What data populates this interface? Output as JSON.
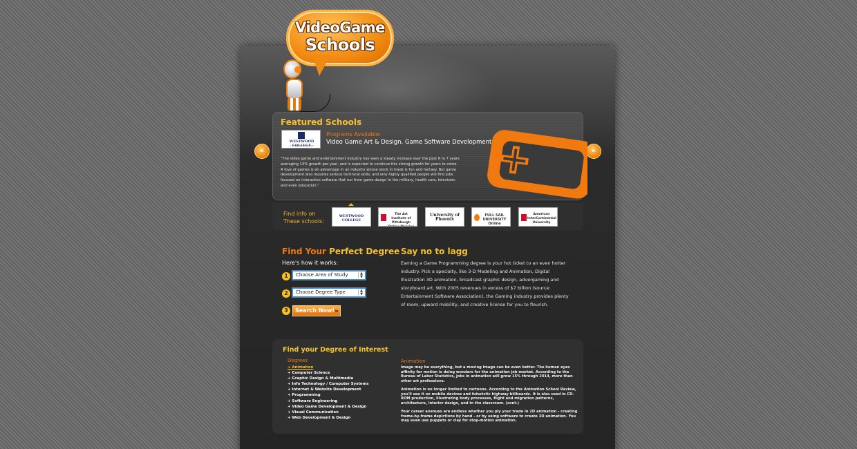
{
  "logo": {
    "line1": "VideoGame",
    "line2": "Schools"
  },
  "featured": {
    "title": "Featured Schools",
    "school_logo": {
      "name": "WESTWOOD COLLEGE",
      "sub": "A DEVRY INSTITUTE OF TECHNOLOGY"
    },
    "programs_label": "Programs Available:",
    "programs_value": "Video Game Art & Design, Game Software Development",
    "quote": "\"The video game and entertainment industry has seen a steady increase over the past 6 to 7 years averaging 14% growth per year, and is expected to continue this strong growth for years to come. A love of games is an advantage in an industry whose stock in trade is fun and fantasy. But game development also requires serious technical skills, and only highly qualified people will find jobs focused on interactive software that run from game design to the military, health care, television and even education.\"",
    "prev_arrow": "«",
    "next_arrow": "»"
  },
  "schools_strip": {
    "label": "Find info on These schools:",
    "schools": [
      {
        "name": "WESTWOOD COLLEGE"
      },
      {
        "name": "The Art Institute of Pittsburgh Online Division"
      },
      {
        "name": "University of Phoenix"
      },
      {
        "name": "FULL SAIL UNIVERSITY Online"
      },
      {
        "name": "American InterContinental University"
      }
    ]
  },
  "finder": {
    "title_a": "Find Your",
    "title_b": "Perfect Degree",
    "how": "Here's how it works:",
    "step1": "1",
    "step2": "2",
    "step3": "3",
    "area_select": "Choose Area of Study",
    "degree_select": "Choose Degree Type",
    "search_button": "Search Now!"
  },
  "lagg": {
    "title": "Say no to lagg",
    "text": "Earning a Game Programming degree is your hot ticket to an even hotter industry. Pick a specialty, like 3-D Modeling and Animation, Digital Illustration 3D animation, broadcast graphic design, advergaming and storyboard art. With 2005 revenues in excess of $7 billion (source: Entertainment Software Association), the Gaming industry provides plenty of room, upward mobility, and creative license for you to flourish."
  },
  "interest": {
    "title": "Find your Degree of Interest",
    "degrees_label": "Degrees",
    "degrees": [
      "+ Animation",
      "+ Computer Science",
      "+ Graphic Design & Multimedia",
      "+ Info Technology / Computer Systems",
      "+ Internet & Website Development",
      "+ Programming",
      "+ Software Engineering",
      "+ Video Game Development & Design",
      "+ Visual Communication",
      "+ Web Development & Design"
    ],
    "active_degree": 0,
    "animation_title": "Animation",
    "animation_paragraphs": [
      "Image may be everything, but a moving image can be even better. The human eyes affinity for motion is doing wonders for the animation job market. According to the Bureau of Labor Statistics, jobs in animation will grow 15% through 2014, more than other art professions.",
      "Animation is no longer limited to cartoons. According to the Animation School Review, you'll see it on mobile devices and futuristic highway billboards. It is also used in CD-ROM production, illustrating body processes, flight and migration patterns, architecture, interior design, and in the classroom. (cont.)",
      "Your career avenues are endless whether you ply your trade in 2D animation - creating frame-by-frame depictions by hand - or by using software to create 3D animation. You may even use puppets or clay for stop-motion animation."
    ]
  },
  "colors": {
    "accent_orange": "#f07a10",
    "accent_yellow": "#f6c22a",
    "panel": "#303030"
  }
}
